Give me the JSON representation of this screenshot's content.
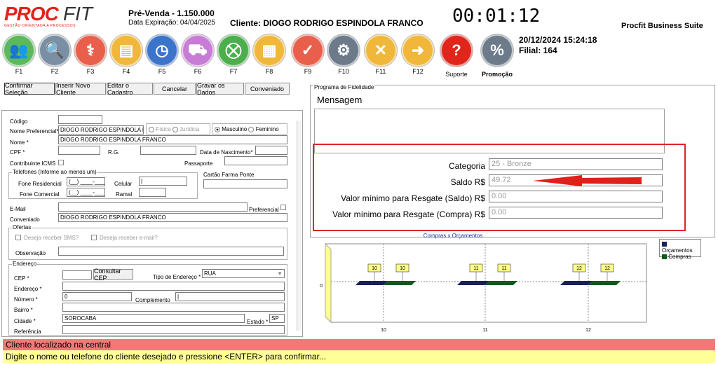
{
  "logo": {
    "proc": "PROC",
    "fit": "FIT",
    "tagline": "GESTÃO ORIENTADA A PROCESSOS"
  },
  "header": {
    "presale": "Pré-Venda - 1.150.000",
    "expiration": "Data Expiração: 04/04/2025",
    "client": "Cliente: DIOGO RODRIGO ESPINDOLA FRANCO",
    "timer": "00:01:12",
    "suite": "Procfit Business Suite",
    "datetime": "20/12/2024 15:24:18",
    "branch": "Filial: 164"
  },
  "fkeys": [
    {
      "label": "F1",
      "icon": "users-icon",
      "color": "#5cb85c",
      "glyph": "👥"
    },
    {
      "label": "F2",
      "icon": "search-icon",
      "color": "#7a8fa3",
      "glyph": "🔍"
    },
    {
      "label": "F3",
      "icon": "caduceus-icon",
      "color": "#e8604c",
      "glyph": "⚕"
    },
    {
      "label": "F4",
      "icon": "id-card-icon",
      "color": "#f0b73a",
      "glyph": "▤"
    },
    {
      "label": "F5",
      "icon": "clock-icon",
      "color": "#3b74c9",
      "glyph": "◷"
    },
    {
      "label": "F6",
      "icon": "truck-icon",
      "color": "#c77dd6",
      "glyph": "⛟"
    },
    {
      "label": "F7",
      "icon": "cart-icon",
      "color": "#4cae4c",
      "glyph": "⛒"
    },
    {
      "label": "F8",
      "icon": "contact-card-icon",
      "color": "#f0b73a",
      "glyph": "▦"
    },
    {
      "label": "F9",
      "icon": "check-icon",
      "color": "#e8604c",
      "glyph": "✓"
    },
    {
      "label": "F10",
      "icon": "gears-icon",
      "color": "#6c7a8a",
      "glyph": "⚙"
    },
    {
      "label": "F11",
      "icon": "cancel-icon",
      "color": "#f0b73a",
      "glyph": "✕"
    },
    {
      "label": "F12",
      "icon": "arrow-right-icon",
      "color": "#f0b73a",
      "glyph": "➜"
    },
    {
      "label": "Suporte",
      "icon": "help-icon",
      "color": "#e0251b",
      "glyph": "?"
    },
    {
      "label": "Promoção",
      "icon": "promotion-icon",
      "color": "#6c7a8a",
      "glyph": "%"
    }
  ],
  "toolbar": {
    "confirm": "Confirmar Seleção",
    "insert": "Inserir Novo Cliente",
    "edit": "Editar o Cadastro",
    "cancel": "Cancelar",
    "save": "Gravar os Dados",
    "convenient": "Conveniado"
  },
  "form": {
    "code_label": "Código",
    "preferred_label": "Nome Preferencial*",
    "preferred_value": "DIOGO RODRIGO ESPINDOLA F",
    "fisica": "Física",
    "juridica": "Jurídica",
    "masculino": "Masculino",
    "feminino": "Feminino",
    "name_label": "Nome *",
    "name_value": "DIOGO RODRIGO ESPINDOLA FRANCO",
    "cpf_label": "CPF *",
    "rg_label": "R.G.",
    "birth_label": "Data de Nascimento*",
    "icms_label": "Contribuinte ICMS",
    "passport_label": "Passaporte",
    "phones_title": "Telefones (Informe ao menos um)",
    "home_phone_label": "Fone Residencial",
    "home_phone_value": "(__) ____-____",
    "cell_label": "Celular",
    "cell_value": "|",
    "work_phone_label": "Fone Comercial",
    "work_phone_value": "(__) ____-____",
    "ext_label": "Ramal",
    "farma_label": "Cartão Farma Ponte",
    "email_label": "E-Mail",
    "preferred_check": "Preferencial",
    "convenient_label": "Conveniado",
    "convenient_value": "DIOGO RODRIGO ESPINDOLA FRANCO",
    "offers_title": "Ofertas",
    "sms_label": "Deseja receber SMS?",
    "emailoffer_label": "Deseja receber e-mail?",
    "obs_label": "Observação",
    "address_title": "Endereço",
    "cep_label": "CEP *",
    "cep_button": "Consultar CEP",
    "addr_type_label": "Tipo de Endereço *",
    "addr_type_value": "RUA",
    "street_label": "Endereço *",
    "number_label": "Número *",
    "number_value": "0",
    "complement_label": "Complemento",
    "complement_value": "|",
    "district_label": "Bairro *",
    "city_label": "Cidade *",
    "city_value": "SOROCABA",
    "state_label": "Estado *",
    "state_value": "SP",
    "reference_label": "Referência"
  },
  "loyalty": {
    "title": "Programa de Fidelidade",
    "message_label": "Mensagem",
    "category_label": "Categoria",
    "category_value": "25 - Bronze",
    "balance_label": "Saldo R$",
    "balance_value": "49.72",
    "min_balance_label": "Valor mínimo para Resgate (Saldo) R$",
    "min_balance_value": "0.00",
    "min_purchase_label": "Valor mínimo para Resgate (Compra) R$",
    "min_purchase_value": "0.00"
  },
  "chart_data": {
    "type": "bar",
    "title": "Compras x Orçamentos",
    "categories": [
      "10",
      "11",
      "12"
    ],
    "series": [
      {
        "name": "Orçamentos",
        "values": [
          0,
          0,
          0
        ],
        "labels": [
          "10",
          "11",
          "12"
        ],
        "color": "#1a1f5e"
      },
      {
        "name": "Compras",
        "values": [
          0,
          0,
          0
        ],
        "labels": [
          "10",
          "11",
          "12"
        ],
        "color": "#0e5a1e"
      }
    ],
    "y_tick": "0",
    "legend": "top-right"
  },
  "status": {
    "found": "Cliente localizado na central",
    "hint": "Digite o nome ou telefone do cliente desejado e pressione <ENTER> para confirmar..."
  }
}
